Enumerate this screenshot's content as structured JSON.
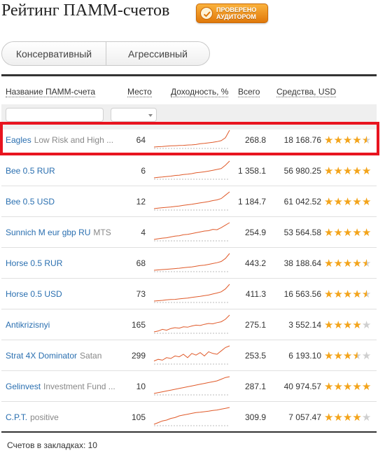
{
  "page": {
    "title": "Рейтинг ПАММ-счетов",
    "badge": {
      "line1": "Проверено",
      "line2": "аудитором",
      "icon": "checkmark-seal-icon"
    },
    "tabs": [
      "Консервативный",
      "Агрессивный"
    ],
    "colors": {
      "link": "#2a6fb0",
      "star": "#f3a41b",
      "highlight": "#e8141f",
      "spark": "#e05a2a"
    }
  },
  "table": {
    "headers": {
      "name": "Название ПАММ-счета",
      "place": "Место",
      "yield": "Доходность, %",
      "total": "Всего",
      "funds": "Средства, USD"
    },
    "rows": [
      {
        "name": "Eagles",
        "suffix": "Low Risk and High ...",
        "place": "64",
        "total": "268.8",
        "funds": "18 168.76",
        "rating": 4.5,
        "highlighted": true,
        "spark": [
          0,
          0.02,
          0.03,
          0.05,
          0.07,
          0.08,
          0.09,
          0.1,
          0.12,
          0.13,
          0.15,
          0.2,
          0.22,
          0.25,
          0.28,
          0.32,
          0.38,
          0.55,
          1
        ]
      },
      {
        "name": "Bee 0.5 RUR",
        "suffix": "",
        "place": "6",
        "total": "1 358.1",
        "funds": "56 980.25",
        "rating": 5,
        "highlighted": false,
        "spark": [
          0,
          0.03,
          0.05,
          0.08,
          0.1,
          0.14,
          0.16,
          0.2,
          0.22,
          0.25,
          0.3,
          0.33,
          0.36,
          0.4,
          0.45,
          0.5,
          0.55,
          0.75,
          1
        ]
      },
      {
        "name": "Bee 0.5 USD",
        "suffix": "",
        "place": "12",
        "total": "1 184.7",
        "funds": "61 042.52",
        "rating": 5,
        "highlighted": false,
        "spark": [
          0,
          0.03,
          0.06,
          0.08,
          0.1,
          0.13,
          0.16,
          0.2,
          0.23,
          0.26,
          0.3,
          0.34,
          0.38,
          0.42,
          0.48,
          0.52,
          0.6,
          0.8,
          1
        ]
      },
      {
        "name": "Sunnich M eur gbp RU",
        "suffix": "MTS",
        "place": "4",
        "total": "254.9",
        "funds": "53 564.58",
        "rating": 5,
        "highlighted": false,
        "spark": [
          0,
          0.04,
          0.08,
          0.1,
          0.15,
          0.2,
          0.22,
          0.28,
          0.3,
          0.35,
          0.4,
          0.45,
          0.5,
          0.52,
          0.6,
          0.58,
          0.7,
          0.85,
          1
        ]
      },
      {
        "name": "Horse 0.5 RUR",
        "suffix": "",
        "place": "68",
        "total": "443.2",
        "funds": "38 188.64",
        "rating": 4.5,
        "highlighted": false,
        "spark": [
          0,
          0.02,
          0.04,
          0.06,
          0.08,
          0.1,
          0.12,
          0.15,
          0.18,
          0.2,
          0.24,
          0.28,
          0.3,
          0.35,
          0.4,
          0.45,
          0.52,
          0.7,
          1
        ]
      },
      {
        "name": "Horse 0.5 USD",
        "suffix": "",
        "place": "73",
        "total": "411.3",
        "funds": "16 563.56",
        "rating": 4.5,
        "highlighted": false,
        "spark": [
          0,
          0.02,
          0.04,
          0.07,
          0.09,
          0.1,
          0.13,
          0.16,
          0.18,
          0.22,
          0.25,
          0.28,
          0.32,
          0.36,
          0.42,
          0.48,
          0.55,
          0.72,
          1
        ]
      },
      {
        "name": "Antikrizisnyi",
        "suffix": "",
        "place": "165",
        "total": "275.1",
        "funds": "3 552.14",
        "rating": 4,
        "highlighted": false,
        "spark": [
          0,
          0.05,
          0.15,
          0.1,
          0.2,
          0.25,
          0.22,
          0.3,
          0.28,
          0.35,
          0.4,
          0.38,
          0.45,
          0.5,
          0.48,
          0.55,
          0.6,
          0.75,
          1
        ]
      },
      {
        "name": "Strat 4X Dominator",
        "suffix": "Satan",
        "place": "299",
        "total": "253.5",
        "funds": "6 193.10",
        "rating": 3.5,
        "highlighted": false,
        "spark": [
          0.1,
          0.2,
          0.15,
          0.3,
          0.25,
          0.4,
          0.35,
          0.5,
          0.3,
          0.55,
          0.45,
          0.6,
          0.4,
          0.65,
          0.55,
          0.5,
          0.7,
          0.9,
          1
        ]
      },
      {
        "name": "Gelinvest",
        "suffix": "Investment Fund ...",
        "place": "10",
        "total": "287.1",
        "funds": "40 974.57",
        "rating": 5,
        "highlighted": false,
        "spark": [
          0,
          0.05,
          0.1,
          0.15,
          0.2,
          0.25,
          0.3,
          0.35,
          0.4,
          0.45,
          0.5,
          0.55,
          0.6,
          0.65,
          0.7,
          0.75,
          0.85,
          0.95,
          1
        ]
      },
      {
        "name": "C.P.T.",
        "suffix": "positive",
        "place": "105",
        "total": "309.9",
        "funds": "7 057.47",
        "rating": 4,
        "highlighted": false,
        "spark": [
          0,
          0.1,
          0.2,
          0.25,
          0.35,
          0.4,
          0.5,
          0.55,
          0.6,
          0.65,
          0.7,
          0.72,
          0.75,
          0.78,
          0.82,
          0.85,
          0.9,
          0.95,
          1
        ]
      }
    ]
  },
  "footer": {
    "bookmarks": "Счетов в закладках: 10"
  }
}
